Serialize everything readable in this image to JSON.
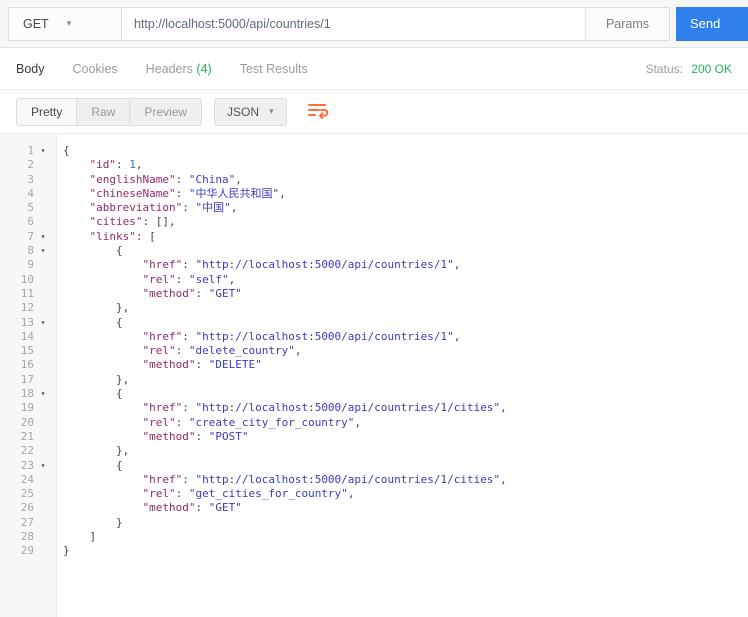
{
  "colors": {
    "accent-orange": "#ff6c37",
    "send-blue": "#2f80ed",
    "status-green": "#27ae60",
    "tok-key": "#922b67",
    "tok-str": "#3b3bbf",
    "tok-num": "#2e74b5",
    "tok-punct": "#444444"
  },
  "icons": {
    "caret_down": "▾",
    "fold_arrow": "▾"
  },
  "request_bar": {
    "method": "GET",
    "url": "http://localhost:5000/api/countries/1",
    "params_label": "Params",
    "send_label": "Send"
  },
  "response_tabs": {
    "body": "Body",
    "cookies": "Cookies",
    "headers": "Headers",
    "headers_count": "(4)",
    "test_results": "Test Results",
    "status_label": "Status:",
    "status_value": "200 OK"
  },
  "view_toolbar": {
    "pretty": "Pretty",
    "raw": "Raw",
    "preview": "Preview",
    "format": "JSON",
    "wrap_icon": "line-wrap-icon"
  },
  "editor": {
    "lines": [
      {
        "n": 1,
        "fold": true,
        "tokens": [
          {
            "t": "p",
            "v": "{"
          }
        ]
      },
      {
        "n": 2,
        "fold": false,
        "tokens": [
          {
            "t": "ws",
            "v": "    "
          },
          {
            "t": "key",
            "v": "\"id\""
          },
          {
            "t": "p",
            "v": ": "
          },
          {
            "t": "num",
            "v": "1"
          },
          {
            "t": "p",
            "v": ","
          }
        ]
      },
      {
        "n": 3,
        "fold": false,
        "tokens": [
          {
            "t": "ws",
            "v": "    "
          },
          {
            "t": "key",
            "v": "\"englishName\""
          },
          {
            "t": "p",
            "v": ": "
          },
          {
            "t": "str",
            "v": "\"China\""
          },
          {
            "t": "p",
            "v": ","
          }
        ]
      },
      {
        "n": 4,
        "fold": false,
        "tokens": [
          {
            "t": "ws",
            "v": "    "
          },
          {
            "t": "key",
            "v": "\"chineseName\""
          },
          {
            "t": "p",
            "v": ": "
          },
          {
            "t": "str",
            "v": "\"中华人民共和国\""
          },
          {
            "t": "p",
            "v": ","
          }
        ]
      },
      {
        "n": 5,
        "fold": false,
        "tokens": [
          {
            "t": "ws",
            "v": "    "
          },
          {
            "t": "key",
            "v": "\"abbreviation\""
          },
          {
            "t": "p",
            "v": ": "
          },
          {
            "t": "str",
            "v": "\"中国\""
          },
          {
            "t": "p",
            "v": ","
          }
        ]
      },
      {
        "n": 6,
        "fold": false,
        "tokens": [
          {
            "t": "ws",
            "v": "    "
          },
          {
            "t": "key",
            "v": "\"cities\""
          },
          {
            "t": "p",
            "v": ": "
          },
          {
            "t": "p",
            "v": "[],"
          }
        ]
      },
      {
        "n": 7,
        "fold": true,
        "tokens": [
          {
            "t": "ws",
            "v": "    "
          },
          {
            "t": "key",
            "v": "\"links\""
          },
          {
            "t": "p",
            "v": ": "
          },
          {
            "t": "p",
            "v": "["
          }
        ]
      },
      {
        "n": 8,
        "fold": true,
        "tokens": [
          {
            "t": "ws",
            "v": "        "
          },
          {
            "t": "p",
            "v": "{"
          }
        ]
      },
      {
        "n": 9,
        "fold": false,
        "tokens": [
          {
            "t": "ws",
            "v": "            "
          },
          {
            "t": "key",
            "v": "\"href\""
          },
          {
            "t": "p",
            "v": ": "
          },
          {
            "t": "str",
            "v": "\"http://localhost:5000/api/countries/1\""
          },
          {
            "t": "p",
            "v": ","
          }
        ]
      },
      {
        "n": 10,
        "fold": false,
        "tokens": [
          {
            "t": "ws",
            "v": "            "
          },
          {
            "t": "key",
            "v": "\"rel\""
          },
          {
            "t": "p",
            "v": ": "
          },
          {
            "t": "str",
            "v": "\"self\""
          },
          {
            "t": "p",
            "v": ","
          }
        ]
      },
      {
        "n": 11,
        "fold": false,
        "tokens": [
          {
            "t": "ws",
            "v": "            "
          },
          {
            "t": "key",
            "v": "\"method\""
          },
          {
            "t": "p",
            "v": ": "
          },
          {
            "t": "str",
            "v": "\"GET\""
          }
        ]
      },
      {
        "n": 12,
        "fold": false,
        "tokens": [
          {
            "t": "ws",
            "v": "        "
          },
          {
            "t": "p",
            "v": "},"
          }
        ]
      },
      {
        "n": 13,
        "fold": true,
        "tokens": [
          {
            "t": "ws",
            "v": "        "
          },
          {
            "t": "p",
            "v": "{"
          }
        ]
      },
      {
        "n": 14,
        "fold": false,
        "tokens": [
          {
            "t": "ws",
            "v": "            "
          },
          {
            "t": "key",
            "v": "\"href\""
          },
          {
            "t": "p",
            "v": ": "
          },
          {
            "t": "str",
            "v": "\"http://localhost:5000/api/countries/1\""
          },
          {
            "t": "p",
            "v": ","
          }
        ]
      },
      {
        "n": 15,
        "fold": false,
        "tokens": [
          {
            "t": "ws",
            "v": "            "
          },
          {
            "t": "key",
            "v": "\"rel\""
          },
          {
            "t": "p",
            "v": ": "
          },
          {
            "t": "str",
            "v": "\"delete_country\""
          },
          {
            "t": "p",
            "v": ","
          }
        ]
      },
      {
        "n": 16,
        "fold": false,
        "tokens": [
          {
            "t": "ws",
            "v": "            "
          },
          {
            "t": "key",
            "v": "\"method\""
          },
          {
            "t": "p",
            "v": ": "
          },
          {
            "t": "str",
            "v": "\"DELETE\""
          }
        ]
      },
      {
        "n": 17,
        "fold": false,
        "tokens": [
          {
            "t": "ws",
            "v": "        "
          },
          {
            "t": "p",
            "v": "},"
          }
        ]
      },
      {
        "n": 18,
        "fold": true,
        "tokens": [
          {
            "t": "ws",
            "v": "        "
          },
          {
            "t": "p",
            "v": "{"
          }
        ]
      },
      {
        "n": 19,
        "fold": false,
        "tokens": [
          {
            "t": "ws",
            "v": "            "
          },
          {
            "t": "key",
            "v": "\"href\""
          },
          {
            "t": "p",
            "v": ": "
          },
          {
            "t": "str",
            "v": "\"http://localhost:5000/api/countries/1/cities\""
          },
          {
            "t": "p",
            "v": ","
          }
        ]
      },
      {
        "n": 20,
        "fold": false,
        "tokens": [
          {
            "t": "ws",
            "v": "            "
          },
          {
            "t": "key",
            "v": "\"rel\""
          },
          {
            "t": "p",
            "v": ": "
          },
          {
            "t": "str",
            "v": "\"create_city_for_country\""
          },
          {
            "t": "p",
            "v": ","
          }
        ]
      },
      {
        "n": 21,
        "fold": false,
        "tokens": [
          {
            "t": "ws",
            "v": "            "
          },
          {
            "t": "key",
            "v": "\"method\""
          },
          {
            "t": "p",
            "v": ": "
          },
          {
            "t": "str",
            "v": "\"POST\""
          }
        ]
      },
      {
        "n": 22,
        "fold": false,
        "tokens": [
          {
            "t": "ws",
            "v": "        "
          },
          {
            "t": "p",
            "v": "},"
          }
        ]
      },
      {
        "n": 23,
        "fold": true,
        "tokens": [
          {
            "t": "ws",
            "v": "        "
          },
          {
            "t": "p",
            "v": "{"
          }
        ]
      },
      {
        "n": 24,
        "fold": false,
        "tokens": [
          {
            "t": "ws",
            "v": "            "
          },
          {
            "t": "key",
            "v": "\"href\""
          },
          {
            "t": "p",
            "v": ": "
          },
          {
            "t": "str",
            "v": "\"http://localhost:5000/api/countries/1/cities\""
          },
          {
            "t": "p",
            "v": ","
          }
        ]
      },
      {
        "n": 25,
        "fold": false,
        "tokens": [
          {
            "t": "ws",
            "v": "            "
          },
          {
            "t": "key",
            "v": "\"rel\""
          },
          {
            "t": "p",
            "v": ": "
          },
          {
            "t": "str",
            "v": "\"get_cities_for_country\""
          },
          {
            "t": "p",
            "v": ","
          }
        ]
      },
      {
        "n": 26,
        "fold": false,
        "tokens": [
          {
            "t": "ws",
            "v": "            "
          },
          {
            "t": "key",
            "v": "\"method\""
          },
          {
            "t": "p",
            "v": ": "
          },
          {
            "t": "str",
            "v": "\"GET\""
          }
        ]
      },
      {
        "n": 27,
        "fold": false,
        "tokens": [
          {
            "t": "ws",
            "v": "        "
          },
          {
            "t": "p",
            "v": "}"
          }
        ]
      },
      {
        "n": 28,
        "fold": false,
        "tokens": [
          {
            "t": "ws",
            "v": "    "
          },
          {
            "t": "p",
            "v": "]"
          }
        ]
      },
      {
        "n": 29,
        "fold": false,
        "tokens": [
          {
            "t": "p",
            "v": "}"
          }
        ]
      }
    ]
  }
}
